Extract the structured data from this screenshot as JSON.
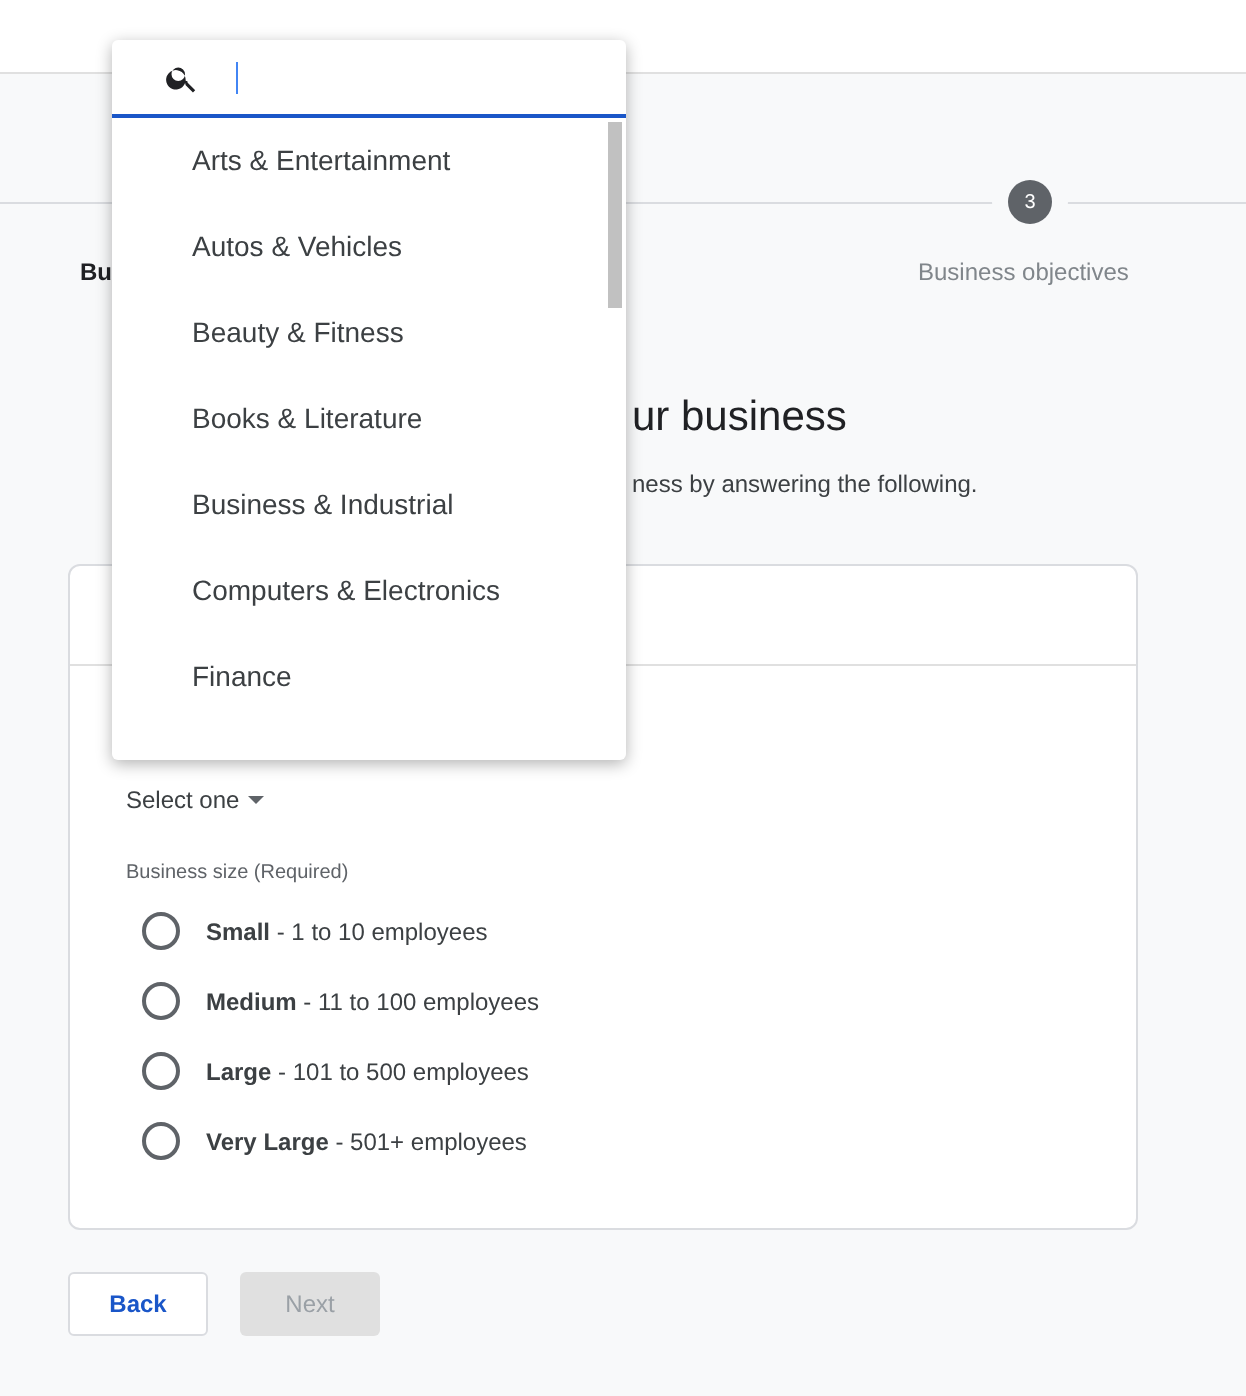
{
  "stepper": {
    "step_number": "3",
    "step_label": "Business objectives",
    "partial_step_label": "Bu"
  },
  "heading": "ur business",
  "subheading": "ness by answering the following.",
  "industry_select": {
    "value": "Select one"
  },
  "business_size": {
    "label": "Business size (Required)",
    "options": [
      {
        "text": "**Small** - 1 to 10 employees",
        "selected": false
      },
      {
        "text": "**Medium** - 11 to 100 employees",
        "selected": false
      },
      {
        "text": "**Large** - 101 to 500 employees",
        "selected": false
      },
      {
        "text": "**Very Large** - 501+ employees",
        "selected": false
      }
    ]
  },
  "buttons": [
    {
      "label": "Back",
      "disabled": false
    },
    {
      "label": "Next",
      "disabled": true
    }
  ],
  "dropdown": {
    "items": [
      "Arts & Entertainment",
      "Autos & Vehicles",
      "Beauty & Fitness",
      "Books & Literature",
      "Business & Industrial",
      "Computers & Electronics",
      "Finance"
    ]
  }
}
